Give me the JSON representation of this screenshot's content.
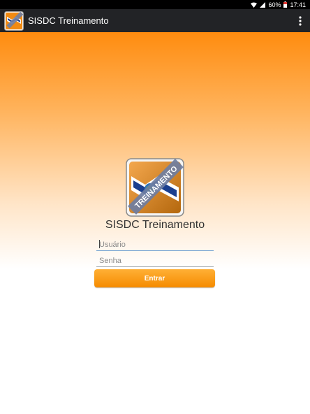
{
  "status_bar": {
    "battery_percent": "60%",
    "time": "17:41",
    "icons": [
      "wifi-icon",
      "signal-icon",
      "battery-icon"
    ]
  },
  "app_bar": {
    "title": "SISDC Treinamento",
    "logo_icon": "app-logo-icon",
    "menu_icon": "overflow-menu-icon"
  },
  "login": {
    "logo_text": "TREINAMENTO",
    "title": "SISDC Treinamento",
    "username_placeholder": "Usuário",
    "password_placeholder": "Senha",
    "submit_label": "Entrar"
  },
  "colors": {
    "accent_orange": "#f58b00",
    "app_bar_bg": "#222326",
    "logo_blue": "#1b3f8f"
  }
}
